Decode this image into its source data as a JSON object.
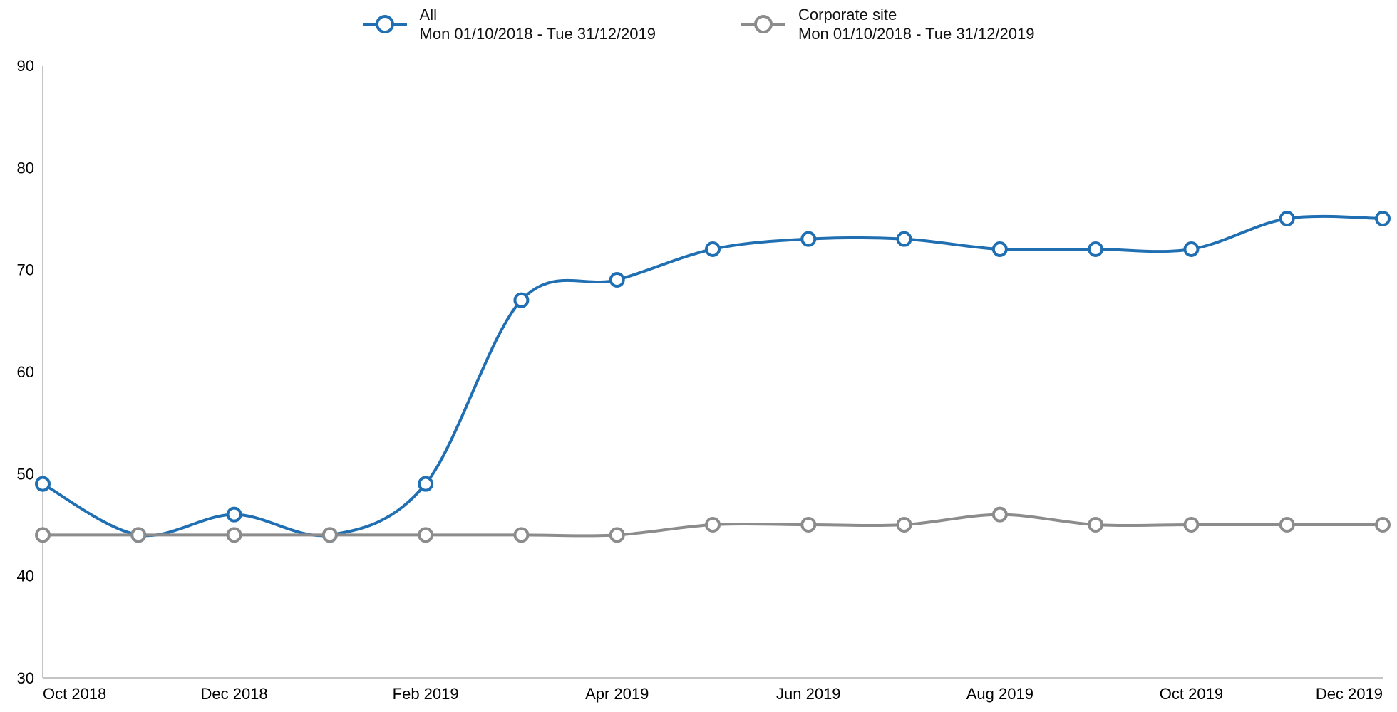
{
  "legend": [
    {
      "name": "All",
      "sub": "Mon 01/10/2018 - Tue 31/12/2019",
      "color": "#1f6fb2"
    },
    {
      "name": "Corporate site",
      "sub": "Mon 01/10/2018 - Tue 31/12/2019",
      "color": "#8c8c8c"
    }
  ],
  "chart_data": {
    "type": "line",
    "x": [
      "Oct 2018",
      "Nov 2018",
      "Dec 2018",
      "Jan 2019",
      "Feb 2019",
      "Mar 2019",
      "Apr 2019",
      "May 2019",
      "Jun 2019",
      "Jul 2019",
      "Aug 2019",
      "Sep 2019",
      "Oct 2019",
      "Nov 2019",
      "Dec 2019"
    ],
    "x_tick_labels": [
      "Oct 2018",
      "",
      "Dec 2018",
      "",
      "Feb 2019",
      "",
      "Apr 2019",
      "",
      "Jun 2019",
      "",
      "Aug 2019",
      "",
      "Oct 2019",
      "",
      "Dec 2019"
    ],
    "series": [
      {
        "name": "All",
        "color": "#1f6fb2",
        "values": [
          49,
          44,
          46,
          44,
          49,
          67,
          69,
          72,
          73,
          73,
          72,
          72,
          72,
          75,
          75
        ]
      },
      {
        "name": "Corporate site",
        "color": "#8c8c8c",
        "values": [
          44,
          44,
          44,
          44,
          44,
          44,
          44,
          45,
          45,
          45,
          46,
          45,
          45,
          45,
          45
        ]
      }
    ],
    "ylim": [
      30,
      90
    ],
    "y_ticks": [
      30,
      40,
      50,
      60,
      70,
      80,
      90
    ],
    "xlabel": "",
    "ylabel": "",
    "title": ""
  }
}
